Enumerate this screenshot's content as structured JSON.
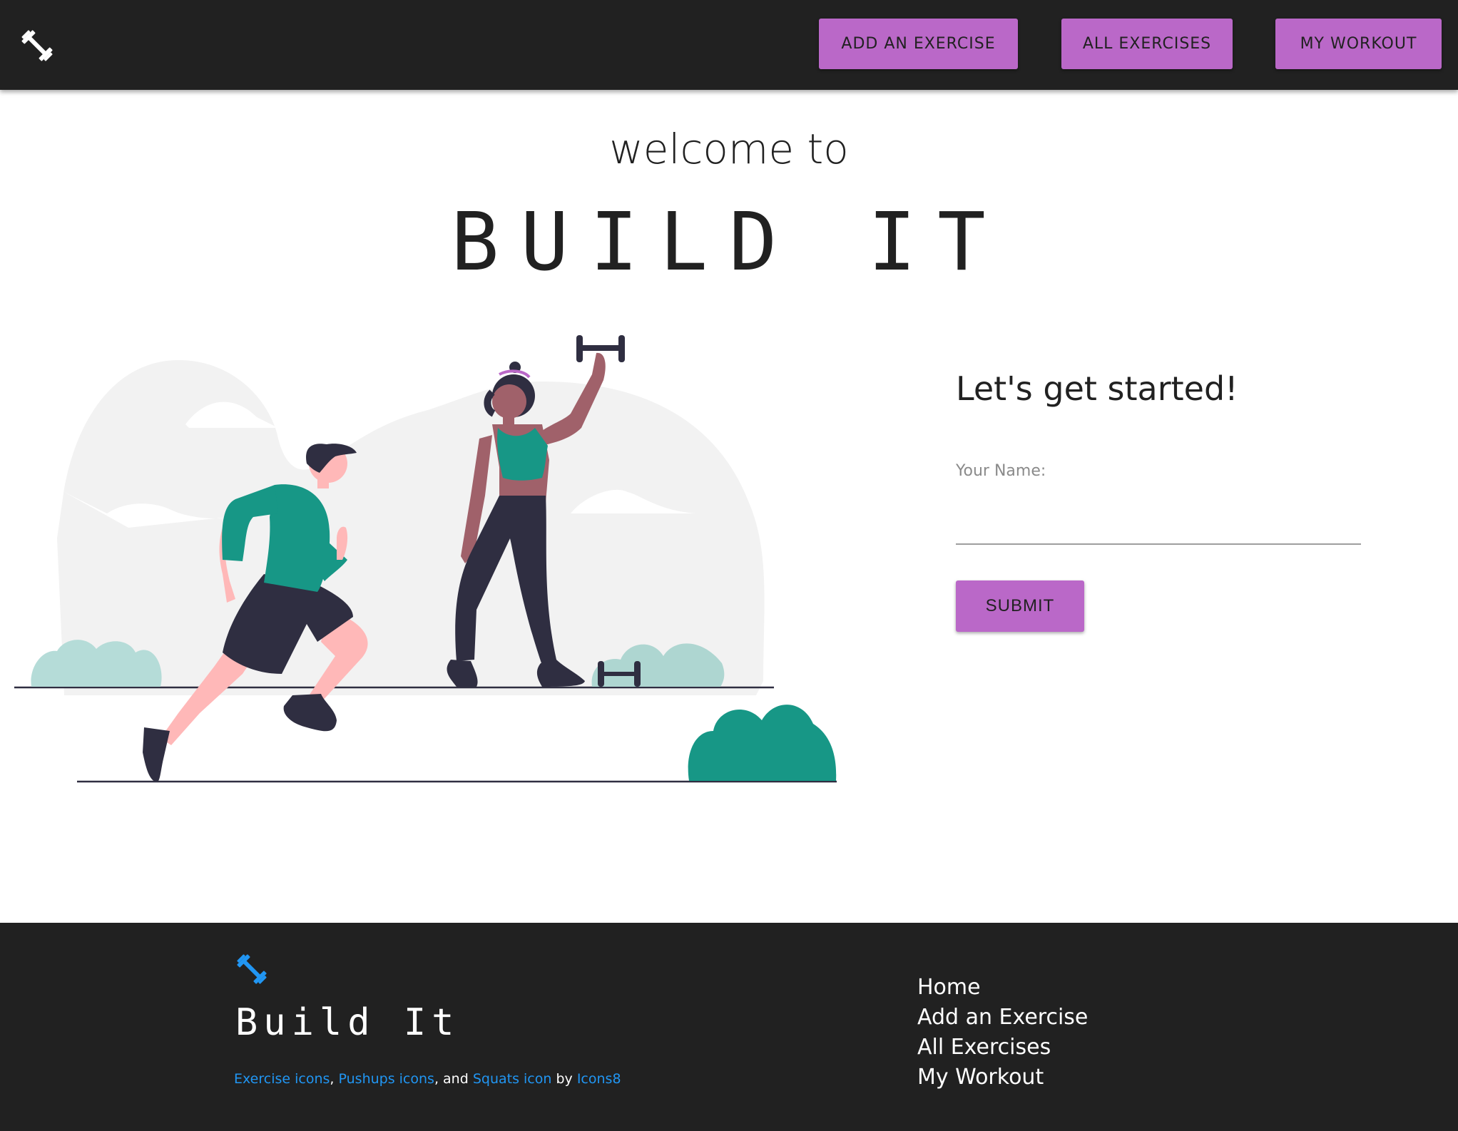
{
  "header": {
    "logo_icon": "dumbbell-icon",
    "nav": {
      "add_exercise": "ADD AN EXERCISE",
      "all_exercises": "ALL EXERCISES",
      "my_workout": "MY WORKOUT"
    }
  },
  "hero": {
    "welcome": "welcome to",
    "title": "BUILD IT",
    "illustration": "people-exercising-illustration"
  },
  "form": {
    "heading": "Let's get started!",
    "name_label": "Your Name:",
    "name_value": "",
    "submit_label": "SUBMIT"
  },
  "footer": {
    "logo_icon": "dumbbell-icon",
    "brand": "Build It",
    "credits": {
      "exercise_icons": "Exercise icons",
      "sep1": ",",
      "pushups_icons": "Pushups icons",
      "sep2": ", and",
      "squats_icon": "Squats icon",
      "by": "by",
      "icons8": "Icons8"
    },
    "links": [
      "Home",
      "Add an Exercise",
      "All Exercises",
      "My Workout"
    ]
  },
  "colors": {
    "navbar_bg": "#212121",
    "accent_purple": "#ba68c8",
    "link_blue": "#2196f3",
    "teal": "#179786"
  }
}
